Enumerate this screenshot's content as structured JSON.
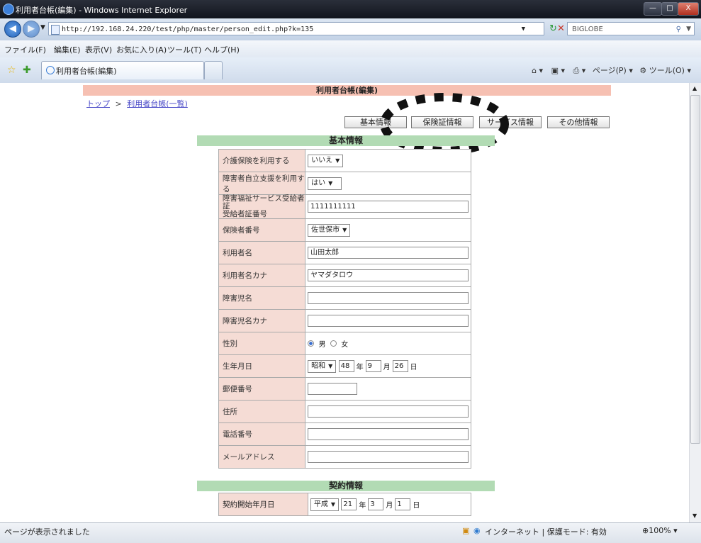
{
  "window": {
    "title": "利用者台帳(編集) - Windows Internet Explorer",
    "minimize": "—",
    "maximize": "□",
    "close": "X"
  },
  "address": {
    "url": "http://192.168.24.220/test/php/master/person_edit.php?k=135",
    "search_placeholder": "BIGLOBE"
  },
  "menu": [
    "ファイル(F)",
    "編集(E)",
    "表示(V)",
    "お気に入り(A)",
    "ツール(T)",
    "ヘルプ(H)"
  ],
  "tab": {
    "title": "利用者台帳(編集)"
  },
  "command_bar": {
    "page": "ページ(P)",
    "tools": "ツール(O)"
  },
  "page": {
    "header": "利用者台帳(編集)",
    "breadcrumb": {
      "top": "トップ",
      "sep": ">",
      "list": "利用者台帳(一覧)"
    },
    "tabs": [
      "基本情報",
      "保険証情報",
      "サービス情報",
      "その他情報"
    ],
    "section_basic": "基本情報",
    "section_contract": "契約情報"
  },
  "form": {
    "care_insurance": {
      "label": "介護保険を利用する",
      "value": "いいえ"
    },
    "disability_support": {
      "label": "障害者自立支援を利用する",
      "value": "はい"
    },
    "welfare_cert": {
      "label1": "障害福祉サービス受給者証",
      "label2": "受給者証番号",
      "value": "1111111111"
    },
    "insurer_no": {
      "label": "保険者番号",
      "value": "佐世保市"
    },
    "user_name": {
      "label": "利用者名",
      "value": "山田太郎"
    },
    "user_kana": {
      "label": "利用者名カナ",
      "value": "ヤマダタロウ"
    },
    "child_name": {
      "label": "障害児名",
      "value": ""
    },
    "child_kana": {
      "label": "障害児名カナ",
      "value": ""
    },
    "gender": {
      "label": "性別",
      "male": "男",
      "female": "女"
    },
    "birthdate": {
      "label": "生年月日",
      "era": "昭和",
      "year": "48",
      "year_unit": "年",
      "month": "9",
      "month_unit": "月",
      "day": "26",
      "day_unit": "日"
    },
    "postal": {
      "label": "郵便番号",
      "value": ""
    },
    "address": {
      "label": "住所",
      "value": ""
    },
    "phone": {
      "label": "電話番号",
      "value": ""
    },
    "email": {
      "label": "メールアドレス",
      "value": ""
    }
  },
  "contract": {
    "start_date": {
      "label": "契約開始年月日",
      "era": "平成",
      "year": "21",
      "year_unit": "年",
      "month": "3",
      "month_unit": "月",
      "day": "1",
      "day_unit": "日"
    }
  },
  "status": {
    "left": "ページが表示されました",
    "zone": "インターネット | 保護モード: 有効",
    "zoom": "100%"
  }
}
